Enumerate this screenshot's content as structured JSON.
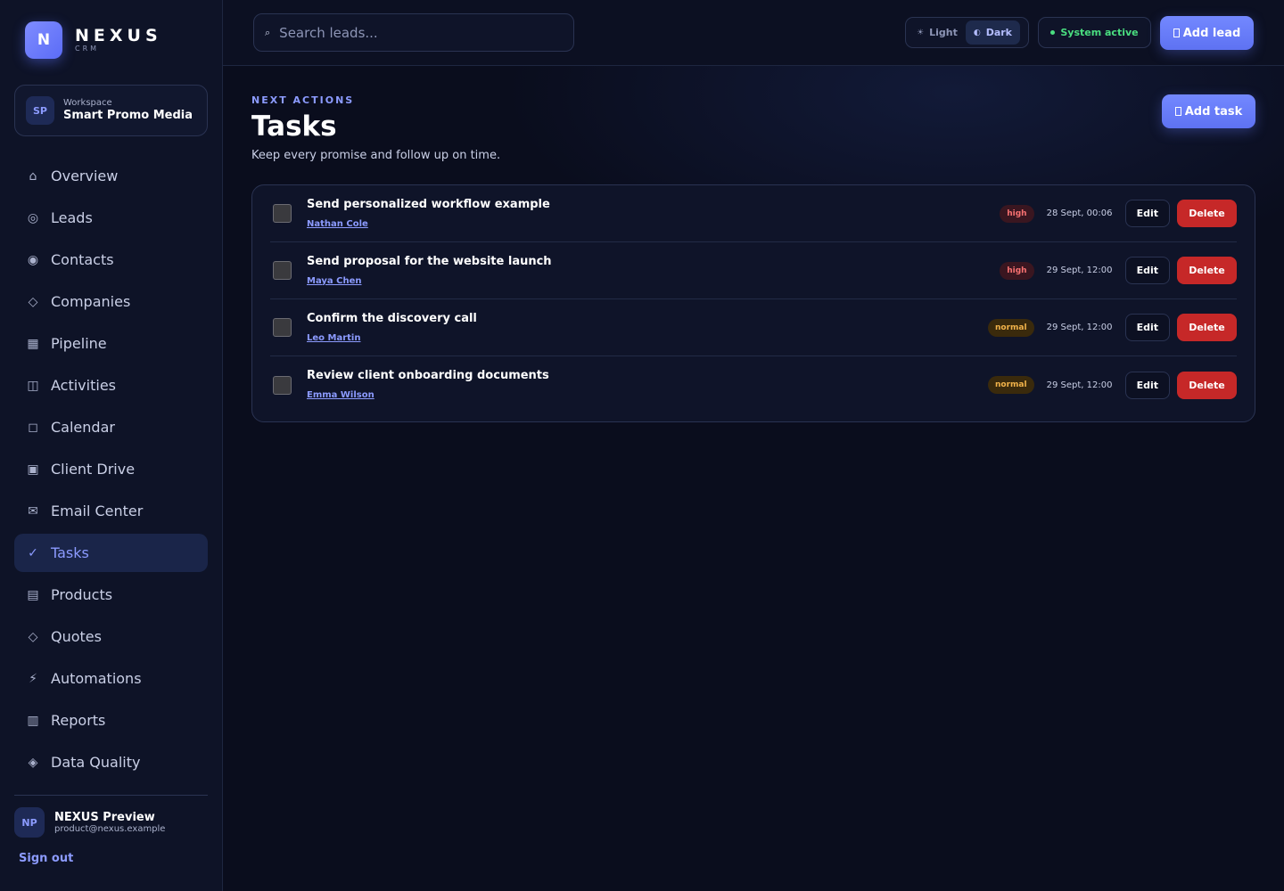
{
  "brand": {
    "mark": "N",
    "name": "NEXUS",
    "sub": "CRM"
  },
  "workspace": {
    "initials": "SP",
    "label": "Workspace",
    "name": "Smart Promo Media"
  },
  "nav": [
    {
      "label": "Overview",
      "icon": "home-icon",
      "glyph": "⌂"
    },
    {
      "label": "Leads",
      "icon": "target-icon",
      "glyph": "◎"
    },
    {
      "label": "Contacts",
      "icon": "contact-icon",
      "glyph": "◉"
    },
    {
      "label": "Companies",
      "icon": "diamond-icon",
      "glyph": "◇"
    },
    {
      "label": "Pipeline",
      "icon": "grid-icon",
      "glyph": "▦"
    },
    {
      "label": "Activities",
      "icon": "columns-icon",
      "glyph": "◫"
    },
    {
      "label": "Calendar",
      "icon": "calendar-icon",
      "glyph": "◻"
    },
    {
      "label": "Client Drive",
      "icon": "drive-icon",
      "glyph": "▣"
    },
    {
      "label": "Email Center",
      "icon": "mail-icon",
      "glyph": "✉"
    },
    {
      "label": "Tasks",
      "icon": "check-icon",
      "glyph": "✓",
      "active": true
    },
    {
      "label": "Products",
      "icon": "list-icon",
      "glyph": "▤"
    },
    {
      "label": "Quotes",
      "icon": "diamond-icon",
      "glyph": "◇"
    },
    {
      "label": "Automations",
      "icon": "bolt-icon",
      "glyph": "⚡"
    },
    {
      "label": "Reports",
      "icon": "chart-icon",
      "glyph": "▥"
    },
    {
      "label": "Data Quality",
      "icon": "shield-diamond-icon",
      "glyph": "◈"
    }
  ],
  "user": {
    "initials": "NP",
    "name": "NEXUS Preview",
    "email": "product@nexus.example",
    "signout": "Sign out"
  },
  "topbar": {
    "search_placeholder": "Search leads...",
    "search_glyph": "⌕",
    "theme_light": "Light",
    "theme_dark": "Dark",
    "theme_light_glyph": "☀",
    "theme_dark_glyph": "◐",
    "status": "System active",
    "add_lead": "Add lead"
  },
  "page": {
    "eyebrow": "NEXT ACTIONS",
    "title": "Tasks",
    "subtitle": "Keep every promise and follow up on time.",
    "add_task": "Add task"
  },
  "tasks": [
    {
      "title": "Send personalized workflow example",
      "contact": "Nathan Cole",
      "priority": "high",
      "date": "28 Sept, 00:06"
    },
    {
      "title": "Send proposal for the website launch",
      "contact": "Maya Chen",
      "priority": "high",
      "date": "29 Sept, 12:00"
    },
    {
      "title": "Confirm the discovery call",
      "contact": "Leo Martin",
      "priority": "normal",
      "date": "29 Sept, 12:00"
    },
    {
      "title": "Review client onboarding documents",
      "contact": "Emma Wilson",
      "priority": "normal",
      "date": "29 Sept, 12:00"
    }
  ],
  "actions": {
    "edit": "Edit",
    "delete": "Delete"
  },
  "colors": {
    "accent": "#8c9bff",
    "primary": "#5e72f2",
    "danger": "#c62828",
    "success": "#4ade80",
    "high": "#f87171",
    "normal": "#f2b34a"
  }
}
